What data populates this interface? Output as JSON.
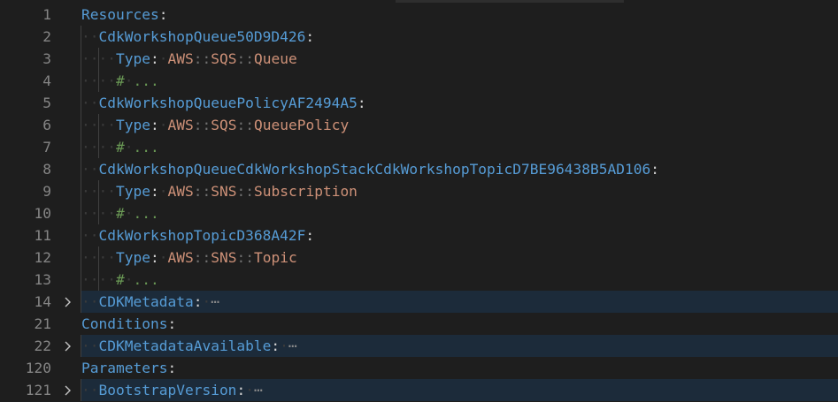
{
  "editor": {
    "lines": [
      {
        "num": "1",
        "indent": 0,
        "key": "Resources",
        "colon": ":"
      },
      {
        "num": "2",
        "indent": 1,
        "key": "CdkWorkshopQueue50D9D426",
        "colon": ":"
      },
      {
        "num": "3",
        "indent": 2,
        "key": "Type",
        "colon": ":",
        "v1": "AWS",
        "v2": "SQS",
        "v3": "Queue"
      },
      {
        "num": "4",
        "indent": 2,
        "comment_hash": "#",
        "comment_text": "..."
      },
      {
        "num": "5",
        "indent": 1,
        "key": "CdkWorkshopQueuePolicyAF2494A5",
        "colon": ":"
      },
      {
        "num": "6",
        "indent": 2,
        "key": "Type",
        "colon": ":",
        "v1": "AWS",
        "v2": "SQS",
        "v3": "QueuePolicy"
      },
      {
        "num": "7",
        "indent": 2,
        "comment_hash": "#",
        "comment_text": "..."
      },
      {
        "num": "8",
        "indent": 1,
        "key": "CdkWorkshopQueueCdkWorkshopStackCdkWorkshopTopicD7BE96438B5AD106",
        "colon": ":"
      },
      {
        "num": "9",
        "indent": 2,
        "key": "Type",
        "colon": ":",
        "v1": "AWS",
        "v2": "SNS",
        "v3": "Subscription"
      },
      {
        "num": "10",
        "indent": 2,
        "comment_hash": "#",
        "comment_text": "..."
      },
      {
        "num": "11",
        "indent": 1,
        "key": "CdkWorkshopTopicD368A42F",
        "colon": ":"
      },
      {
        "num": "12",
        "indent": 2,
        "key": "Type",
        "colon": ":",
        "v1": "AWS",
        "v2": "SNS",
        "v3": "Topic"
      },
      {
        "num": "13",
        "indent": 2,
        "comment_hash": "#",
        "comment_text": "..."
      },
      {
        "num": "14",
        "indent": 1,
        "key": "CDKMetadata",
        "colon": ":",
        "folded": "⋯"
      },
      {
        "num": "21",
        "indent": 0,
        "key": "Conditions",
        "colon": ":"
      },
      {
        "num": "22",
        "indent": 1,
        "key": "CDKMetadataAvailable",
        "colon": ":",
        "folded": "⋯"
      },
      {
        "num": "120",
        "indent": 0,
        "key": "Parameters",
        "colon": ":"
      },
      {
        "num": "121",
        "indent": 1,
        "key": "BootstrapVersion",
        "colon": ":",
        "folded": "⋯"
      }
    ],
    "scope_sep": "::",
    "colors": {
      "background": "#1e1e1e",
      "key": "#569cd6",
      "string": "#ce9178",
      "comment": "#6a9955",
      "line_number": "#858585",
      "folded_highlight": "#1c2b3a"
    }
  }
}
